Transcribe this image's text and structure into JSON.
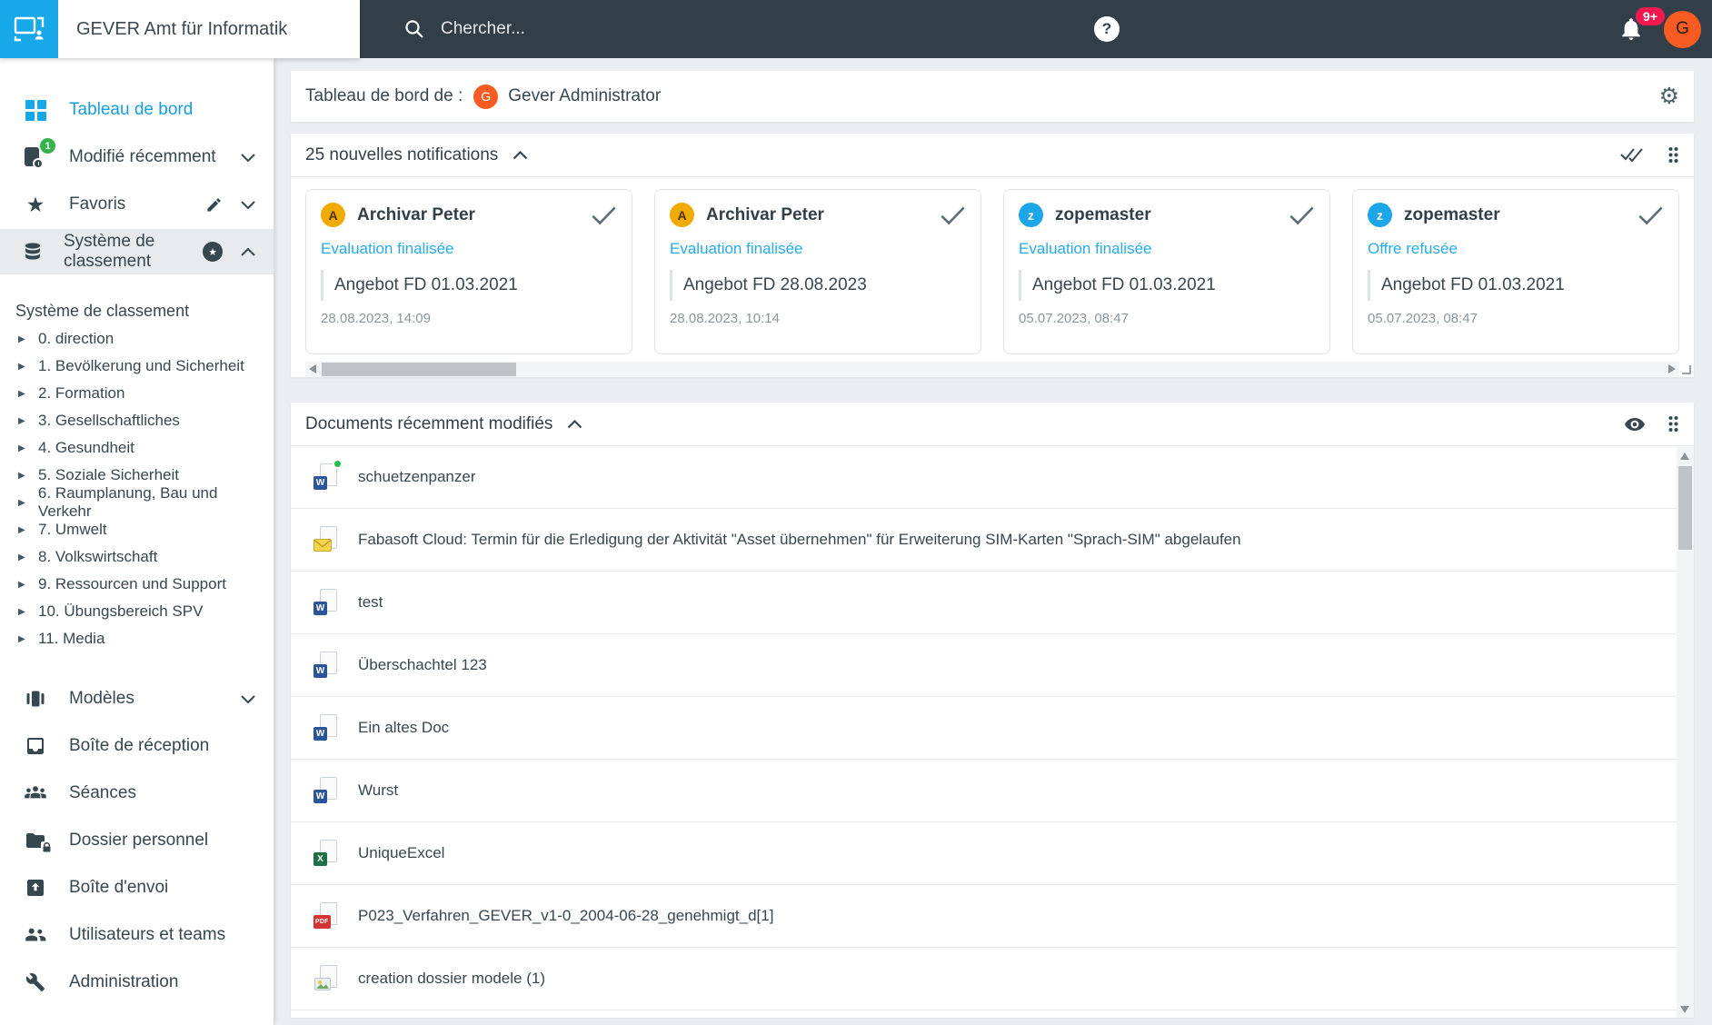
{
  "app": {
    "title": "GEVER Amt für Informatik"
  },
  "topbar": {
    "search_placeholder": "Chercher...",
    "help_glyph": "?",
    "notification_badge": "9+",
    "user_initial": "G"
  },
  "icons": {
    "star_glyph": "★",
    "tree_expand_glyph": "▶",
    "gear_glyph": "⚙",
    "word_glyph": "W",
    "excel_glyph": "X",
    "pdf_glyph": "PDF"
  },
  "colors": {
    "accent_blue": "#17a8ea",
    "topbar_bg": "#333f48",
    "avatar_orange": "#f85c23",
    "avatar_amber": "#f0ab00",
    "avatar_blue": "#1da6e8",
    "badge_red": "#f2194e",
    "badge_green": "#36b24a",
    "link_blue": "#29abe9"
  },
  "sidebar": {
    "items": [
      {
        "label": "Tableau de bord"
      },
      {
        "label": "Modifié récemment",
        "badge": "1"
      },
      {
        "label": "Favoris"
      },
      {
        "label": "Système de classement"
      }
    ],
    "tree": {
      "header": "Système de classement",
      "nodes": [
        "0. direction",
        "1. Bevölkerung und Sicherheit",
        "2. Formation",
        "3. Gesellschaftliches",
        "4. Gesundheit",
        "5. Soziale Sicherheit",
        "6. Raumplanung, Bau und Verkehr",
        "7. Umwelt",
        "8. Volkswirtschaft",
        "9. Ressourcen und Support",
        "10. Übungsbereich SPV",
        "11. Media"
      ]
    },
    "secondary_items": [
      {
        "label": "Modèles"
      },
      {
        "label": "Boîte de réception"
      },
      {
        "label": "Séances"
      },
      {
        "label": "Dossier personnel"
      },
      {
        "label": "Boîte d'envoi"
      },
      {
        "label": "Utilisateurs et teams"
      },
      {
        "label": "Administration"
      }
    ]
  },
  "main": {
    "dashboard_bar": {
      "label": "Tableau de bord de :",
      "user_initial": "G",
      "user_name": "Gever Administrator"
    },
    "notifications": {
      "title": "25 nouvelles notifications",
      "cards": [
        {
          "avatar_initial": "A",
          "name": "Archivar Peter",
          "link": "Evaluation finalisée",
          "quote": "Angebot FD 01.03.2021",
          "timestamp": "28.08.2023, 14:09"
        },
        {
          "avatar_initial": "A",
          "name": "Archivar Peter",
          "link": "Evaluation finalisée",
          "quote": "Angebot FD 28.08.2023",
          "timestamp": "28.08.2023, 10:14"
        },
        {
          "avatar_initial": "z",
          "name": "zopemaster",
          "link": "Evaluation finalisée",
          "quote": "Angebot FD 01.03.2021",
          "timestamp": "05.07.2023, 08:47"
        },
        {
          "avatar_initial": "z",
          "name": "zopemaster",
          "link": "Offre refusée",
          "quote": "Angebot FD 01.03.2021",
          "timestamp": "05.07.2023, 08:47"
        }
      ]
    },
    "documents": {
      "title": "Documents récemment modifiés",
      "items": [
        {
          "name": "schuetzenpanzer",
          "type": "word",
          "unread": true
        },
        {
          "name": "Fabasoft Cloud: Termin für die Erledigung der Aktivität \"Asset übernehmen\" für Erweiterung SIM-Karten \"Sprach-SIM\" abgelaufen",
          "type": "email"
        },
        {
          "name": "test",
          "type": "word"
        },
        {
          "name": "Überschachtel 123",
          "type": "word"
        },
        {
          "name": "Ein altes Doc",
          "type": "word"
        },
        {
          "name": "Wurst",
          "type": "word"
        },
        {
          "name": "UniqueExcel",
          "type": "excel"
        },
        {
          "name": "P023_Verfahren_GEVER_v1-0_2004-06-28_genehmigt_d[1]",
          "type": "pdf"
        },
        {
          "name": "creation dossier modele (1)",
          "type": "image"
        }
      ]
    }
  }
}
